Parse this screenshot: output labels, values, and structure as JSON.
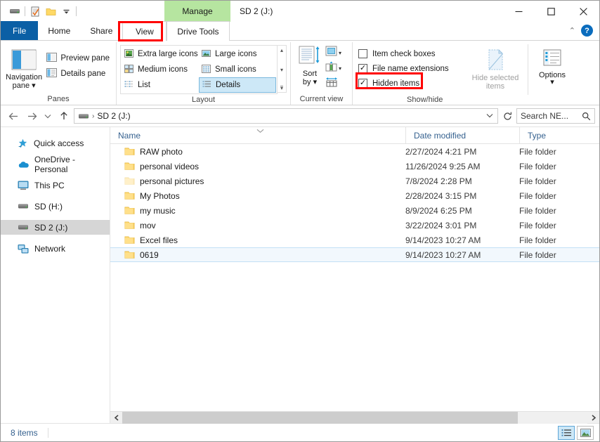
{
  "window": {
    "title": "SD 2 (J:)",
    "minimize_label": "—",
    "maximize_label": "□",
    "close_label": "✕",
    "contextual_tab_label": "Manage"
  },
  "quick_access_toolbar": {
    "items": [
      {
        "name": "drive-icon",
        "label": ""
      },
      {
        "name": "properties-icon",
        "label": ""
      },
      {
        "name": "new-folder-icon",
        "label": ""
      },
      {
        "name": "customize-dropdown-icon",
        "label": "▾"
      }
    ]
  },
  "tabs": [
    {
      "id": "file",
      "label": "File",
      "active": false
    },
    {
      "id": "home",
      "label": "Home",
      "active": false
    },
    {
      "id": "share",
      "label": "Share",
      "active": false
    },
    {
      "id": "view",
      "label": "View",
      "active": true
    },
    {
      "id": "drive-tools",
      "label": "Drive Tools",
      "active": false
    }
  ],
  "tabbar_right": {
    "collapse_ribbon_label": "⌃",
    "help_label": "?"
  },
  "ribbon": {
    "groups": [
      {
        "id": "panes",
        "label": "Panes",
        "big_button": {
          "label_line1": "Navigation",
          "label_line2": "pane ▾",
          "icon": "navigation-pane-icon"
        },
        "small_buttons": [
          {
            "label": "Preview pane",
            "icon": "preview-pane-icon"
          },
          {
            "label": "Details pane",
            "icon": "details-pane-icon"
          }
        ]
      },
      {
        "id": "layout",
        "label": "Layout",
        "items": [
          {
            "label": "Extra large icons",
            "icon": "extra-large-icons-icon",
            "selected": false
          },
          {
            "label": "Large icons",
            "icon": "large-icons-icon",
            "selected": false
          },
          {
            "label": "Medium icons",
            "icon": "medium-icons-icon",
            "selected": false
          },
          {
            "label": "Small icons",
            "icon": "small-icons-icon",
            "selected": false
          },
          {
            "label": "List",
            "icon": "list-icon",
            "selected": false
          },
          {
            "label": "Details",
            "icon": "details-icon",
            "selected": true
          }
        ],
        "scroll_up": "▴",
        "scroll_down": "▾",
        "scroll_expand": "▾"
      },
      {
        "id": "current-view",
        "label": "Current view",
        "sort_by": {
          "label_line1": "Sort",
          "label_line2": "by ▾",
          "icon": "sort-by-icon"
        },
        "side_buttons": [
          {
            "icon": "add-columns-icon",
            "label": "▾"
          },
          {
            "icon": "choose-columns-icon",
            "label": "▾"
          },
          {
            "icon": "size-all-columns-icon",
            "label": ""
          }
        ]
      },
      {
        "id": "show-hide",
        "label": "Show/hide",
        "checkboxes": [
          {
            "label": "Item check boxes",
            "checked": false
          },
          {
            "label": "File name extensions",
            "checked": true
          },
          {
            "label": "Hidden items",
            "checked": true,
            "highlighted": true
          }
        ],
        "hide_selected": {
          "label_line1": "Hide selected",
          "label_line2": "items",
          "disabled": true,
          "icon": "hide-selected-items-icon"
        },
        "options": {
          "label_line1": "Options",
          "label_line2": "▾",
          "icon": "options-icon"
        }
      }
    ]
  },
  "addressbar": {
    "back_label": "←",
    "forward_label": "→",
    "recent_label": "∨",
    "up_label": "↑",
    "path_icon": "drive-icon",
    "path_separator": "›",
    "path_text": "SD 2 (J:)",
    "dropdown_label": "∨",
    "refresh_label": "↻",
    "search_placeholder": "Search NE...",
    "search_value": "",
    "search_icon": "search-icon"
  },
  "navigation_pane": {
    "items": [
      {
        "label": "Quick access",
        "icon": "quick-access-star-icon",
        "selected": false
      },
      {
        "label": "OneDrive - Personal",
        "icon": "onedrive-cloud-icon",
        "selected": false
      },
      {
        "label": "This PC",
        "icon": "this-pc-monitor-icon",
        "selected": false
      },
      {
        "label": "SD (H:)",
        "icon": "drive-icon",
        "selected": false
      },
      {
        "label": "SD 2 (J:)",
        "icon": "drive-icon",
        "selected": true
      },
      {
        "label": "Network",
        "icon": "network-icon",
        "selected": false
      }
    ]
  },
  "file_list": {
    "columns": [
      {
        "key": "name",
        "label": "Name",
        "sorted": true,
        "sort_arrow": "⌄"
      },
      {
        "key": "date",
        "label": "Date modified",
        "sorted": false
      },
      {
        "key": "type",
        "label": "Type",
        "sorted": false
      }
    ],
    "rows": [
      {
        "name": "RAW photo",
        "date": "2/27/2024 4:21 PM",
        "type": "File folder",
        "hidden": false,
        "selected": false
      },
      {
        "name": "personal videos",
        "date": "11/26/2024 9:25 AM",
        "type": "File folder",
        "hidden": false,
        "selected": false
      },
      {
        "name": "personal pictures",
        "date": "7/8/2024 2:28 PM",
        "type": "File folder",
        "hidden": true,
        "selected": false
      },
      {
        "name": "My Photos",
        "date": "2/28/2024 3:15 PM",
        "type": "File folder",
        "hidden": false,
        "selected": false
      },
      {
        "name": "my music",
        "date": "8/9/2024 6:25 PM",
        "type": "File folder",
        "hidden": false,
        "selected": false
      },
      {
        "name": "mov",
        "date": "3/22/2024 3:01 PM",
        "type": "File folder",
        "hidden": false,
        "selected": false
      },
      {
        "name": "Excel files",
        "date": "9/14/2023 10:27 AM",
        "type": "File folder",
        "hidden": false,
        "selected": false
      },
      {
        "name": "0619",
        "date": "9/14/2023 10:27 AM",
        "type": "File folder",
        "hidden": false,
        "selected": true
      }
    ],
    "hscroll": {
      "left_arrow": "‹",
      "right_arrow": "›"
    }
  },
  "statusbar": {
    "item_count": "8 items",
    "view_details_icon": "details-view-icon",
    "view_large_icons_icon": "large-icons-view-icon"
  },
  "annotations": {
    "highlight_color": "#ff0000",
    "contextual_tab_color": "#b6e5a0",
    "selection_color": "#cde8f7",
    "boxes": [
      {
        "target": "view-tab"
      },
      {
        "target": "hidden-items-checkbox"
      }
    ]
  }
}
